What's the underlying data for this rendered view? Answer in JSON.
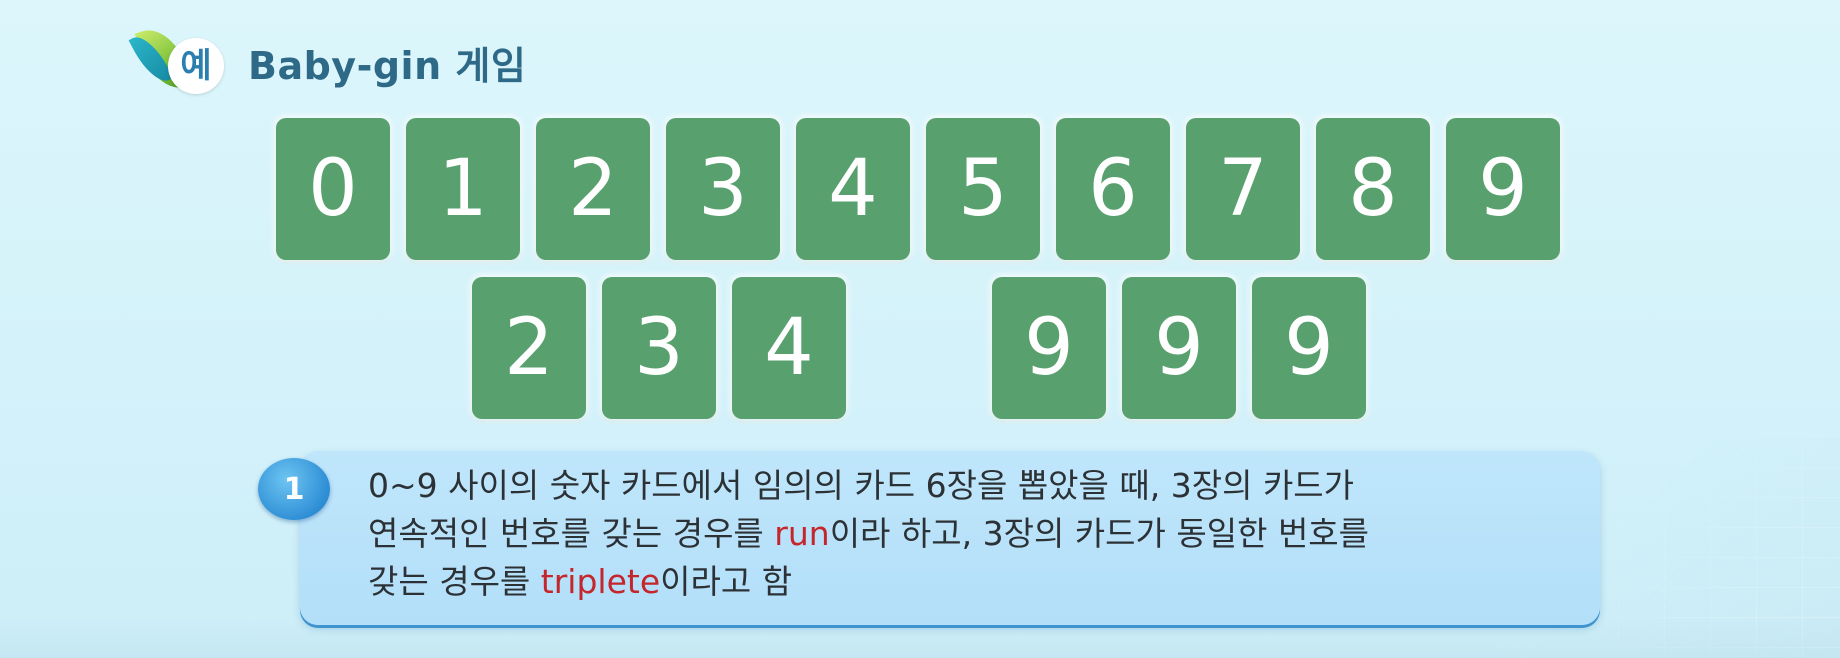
{
  "header": {
    "badge": "예",
    "title": "Baby-gin 게임"
  },
  "cards": {
    "top": [
      "0",
      "1",
      "2",
      "3",
      "4",
      "5",
      "6",
      "7",
      "8",
      "9"
    ],
    "run": [
      "2",
      "3",
      "4"
    ],
    "triplete": [
      "9",
      "9",
      "9"
    ]
  },
  "note": {
    "number": "1",
    "line1": "0~9 사이의 숫자 카드에서 임의의 카드 6장을 뽑았을 때, 3장의 카드가",
    "line2_a": "연속적인 번호를 갖는 경우를 ",
    "line2_hl": "run",
    "line2_b": "이라 하고, 3장의 카드가 동일한 번호를",
    "line3_a": "갖는 경우를 ",
    "line3_hl": "triplete",
    "line3_b": "이라고 함"
  },
  "colors": {
    "card": "#58a06e",
    "highlight": "#c4262c",
    "title": "#2e6a88",
    "panel": "#bfe6fb"
  }
}
